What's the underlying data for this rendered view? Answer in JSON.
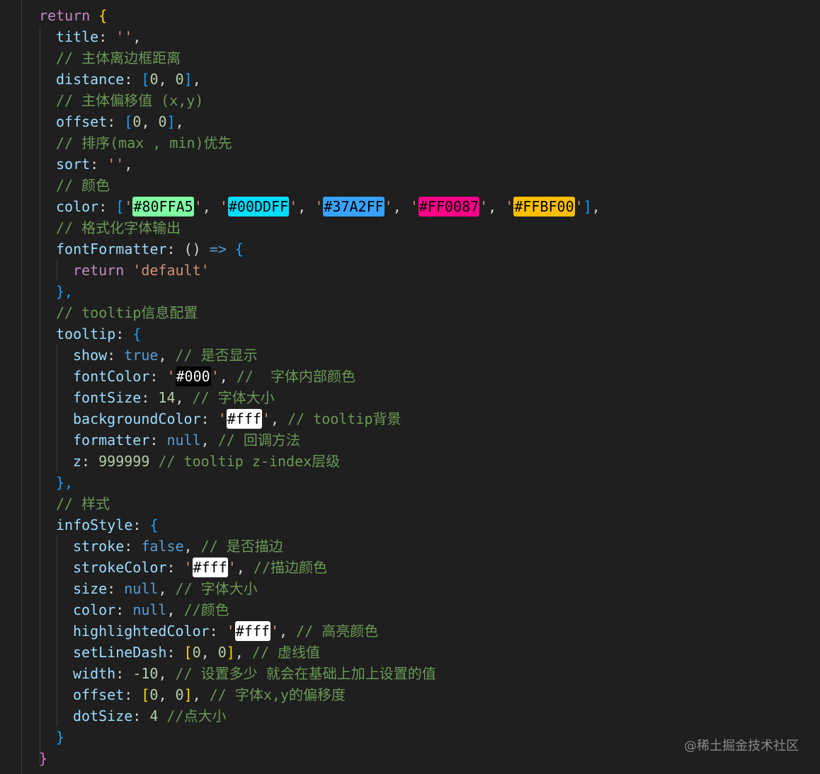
{
  "editor": {
    "colors": {
      "background": "#1f1f1f",
      "keyword": "#c586c0",
      "property": "#9cdcfe",
      "string": "#ce9178",
      "number": "#b5cea8",
      "comment": "#6a9955",
      "boolean": "#569cd6"
    },
    "lines": {
      "l1": {
        "kw": "return",
        "open": "{"
      },
      "l2": {
        "prop": "title",
        "colon": ":",
        "str": "''",
        "tail": ","
      },
      "l3": {
        "cmt": "// 主体离边框距离"
      },
      "l4": {
        "prop": "distance",
        "colon": ":",
        "open": "[",
        "n1": "0",
        "sep": ", ",
        "n2": "0",
        "close": "]",
        "tail": ","
      },
      "l5": {
        "cmt": "// 主体偏移值 (x,y)"
      },
      "l6": {
        "prop": "offset",
        "colon": ":",
        "open": "[",
        "n1": "0",
        "sep": ", ",
        "n2": "0",
        "close": "]",
        "tail": ","
      },
      "l7": {
        "cmt": "// 排序(max , min)优先"
      },
      "l8": {
        "prop": "sort",
        "colon": ":",
        "str": "''",
        "tail": ","
      },
      "l9": {
        "cmt": "// 颜色"
      },
      "l10": {
        "prop": "color",
        "colon": ":",
        "open": "[",
        "close": "]",
        "tail": ",",
        "sep": ", ",
        "quote": "'",
        "values": [
          {
            "text": "#80FFA5",
            "bg": "#80FFA5",
            "fg": "dark"
          },
          {
            "text": "#00DDFF",
            "bg": "#00DDFF",
            "fg": "dark"
          },
          {
            "text": "#37A2FF",
            "bg": "#37A2FF",
            "fg": "dark"
          },
          {
            "text": "#FF0087",
            "bg": "#FF0087",
            "fg": "dark"
          },
          {
            "text": "#FFBF00",
            "bg": "#FFBF00",
            "fg": "dark"
          }
        ]
      },
      "l11": {
        "cmt": "// 格式化字体输出"
      },
      "l12": {
        "prop": "fontFormatter",
        "colon": ":",
        "parens": "()",
        "arrow": "=>",
        "open": "{"
      },
      "l13": {
        "kw": "return",
        "str": "'default'"
      },
      "l14": {
        "close": "},"
      },
      "l15": {
        "cmt": "// tooltip信息配置"
      },
      "l16": {
        "prop": "tooltip",
        "colon": ":",
        "open": "{"
      },
      "l17": {
        "prop": "show",
        "colon": ":",
        "val": "true",
        "tail": ",",
        "cmt": "// 是否显示"
      },
      "l18": {
        "prop": "fontColor",
        "colon": ":",
        "quote": "'",
        "swatch": {
          "text": "#000",
          "bg": "#000000",
          "fg": "light"
        },
        "tail": ",",
        "cmt": "//  字体内部颜色"
      },
      "l19": {
        "prop": "fontSize",
        "colon": ":",
        "val": "14",
        "tail": ",",
        "cmt": "// 字体大小"
      },
      "l20": {
        "prop": "backgroundColor",
        "colon": ":",
        "quote": "'",
        "swatch": {
          "text": "#fff",
          "bg": "#ffffff",
          "fg": "dark"
        },
        "tail": ",",
        "cmt": "// tooltip背景"
      },
      "l21": {
        "prop": "formatter",
        "colon": ":",
        "val": "null",
        "tail": ",",
        "cmt": "// 回调方法"
      },
      "l22": {
        "prop": "z",
        "colon": ":",
        "val": "999999",
        "cmt": "// tooltip z-index层级"
      },
      "l23": {
        "close": "},"
      },
      "l24": {
        "cmt": "// 样式"
      },
      "l25": {
        "prop": "infoStyle",
        "colon": ":",
        "open": "{"
      },
      "l26": {
        "prop": "stroke",
        "colon": ":",
        "val": "false",
        "tail": ",",
        "cmt": "// 是否描边"
      },
      "l27": {
        "prop": "strokeColor",
        "colon": ":",
        "quote": "'",
        "swatch": {
          "text": "#fff",
          "bg": "#ffffff",
          "fg": "dark"
        },
        "tail": ",",
        "cmt": "//描边颜色"
      },
      "l28": {
        "prop": "size",
        "colon": ":",
        "val": "null",
        "tail": ",",
        "cmt": "// 字体大小"
      },
      "l29": {
        "prop": "color",
        "colon": ":",
        "val": "null",
        "tail": ",",
        "cmt": "//颜色"
      },
      "l30": {
        "prop": "highlightedColor",
        "colon": ":",
        "quote": "'",
        "swatch": {
          "text": "#fff",
          "bg": "#ffffff",
          "fg": "dark"
        },
        "tail": ",",
        "cmt": "// 高亮颜色"
      },
      "l31": {
        "prop": "setLineDash",
        "colon": ":",
        "open": "[",
        "n1": "0",
        "sep": ", ",
        "n2": "0",
        "close": "]",
        "tail": ",",
        "cmt": "// 虚线值"
      },
      "l32": {
        "prop": "width",
        "colon": ":",
        "val": "-10",
        "tail": ",",
        "cmt": "// 设置多少 就会在基础上加上设置的值"
      },
      "l33": {
        "prop": "offset",
        "colon": ":",
        "open": "[",
        "n1": "0",
        "sep": ", ",
        "n2": "0",
        "close": "]",
        "tail": ",",
        "cmt": "// 字体x,y的偏移度"
      },
      "l34": {
        "prop": "dotSize",
        "colon": ":",
        "val": "4",
        "cmt": "//点大小"
      },
      "l35": {
        "close": "}"
      },
      "l36": {
        "close": "}"
      }
    }
  },
  "watermark": "@稀土掘金技术社区"
}
